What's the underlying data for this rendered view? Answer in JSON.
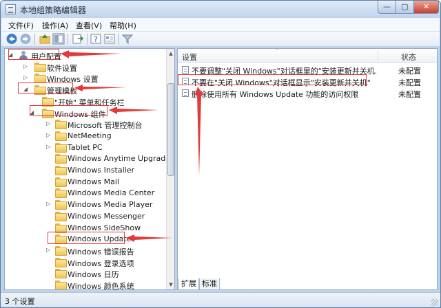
{
  "window": {
    "title": "本地组策略编辑器",
    "controls": {
      "minimize": "—",
      "maximize": "▢",
      "close": "✕"
    }
  },
  "menu": [
    "文件(F)",
    "操作(A)",
    "查看(V)",
    "帮助(H)"
  ],
  "toolbar": {
    "buttons": [
      "back-arrow-icon",
      "forward-arrow-icon",
      "up-folder-icon",
      "show-tree-icon",
      "export-icon",
      "help-icon",
      "properties-icon",
      "filter-icon"
    ]
  },
  "tree": [
    {
      "label": "用户配置",
      "level": 0,
      "expanded": true,
      "icon": "user-icon"
    },
    {
      "label": "软件设置",
      "level": 1,
      "expanded": false,
      "icon": "folder-icon"
    },
    {
      "label": "Windows 设置",
      "level": 1,
      "expanded": false,
      "icon": "folder-icon"
    },
    {
      "label": "管理模板",
      "level": 1,
      "expanded": true,
      "icon": "folder-icon"
    },
    {
      "label": "\"开始\" 菜单和任务栏",
      "level": 2,
      "expanded": null,
      "icon": "folder-icon"
    },
    {
      "label": "Windows 组件",
      "level": 2,
      "expanded": true,
      "icon": "folder-icon"
    },
    {
      "label": "Microsoft 管理控制台",
      "level": 3,
      "expanded": false,
      "icon": "folder-icon"
    },
    {
      "label": "NetMeeting",
      "level": 3,
      "expanded": false,
      "icon": "folder-icon"
    },
    {
      "label": "Tablet PC",
      "level": 3,
      "expanded": false,
      "icon": "folder-icon"
    },
    {
      "label": "Windows Anytime Upgrade",
      "level": 3,
      "expanded": null,
      "icon": "folder-icon"
    },
    {
      "label": "Windows Installer",
      "level": 3,
      "expanded": null,
      "icon": "folder-icon"
    },
    {
      "label": "Windows Mail",
      "level": 3,
      "expanded": null,
      "icon": "folder-icon"
    },
    {
      "label": "Windows Media Center",
      "level": 3,
      "expanded": null,
      "icon": "folder-icon"
    },
    {
      "label": "Windows Media Player",
      "level": 3,
      "expanded": false,
      "icon": "folder-icon"
    },
    {
      "label": "Windows Messenger",
      "level": 3,
      "expanded": null,
      "icon": "folder-icon"
    },
    {
      "label": "Windows SideShow",
      "level": 3,
      "expanded": null,
      "icon": "folder-icon"
    },
    {
      "label": "Windows Update",
      "level": 3,
      "expanded": null,
      "icon": "folder-icon"
    },
    {
      "label": "Windows 错误报告",
      "level": 3,
      "expanded": false,
      "icon": "folder-icon"
    },
    {
      "label": "Windows 登录选项",
      "level": 3,
      "expanded": null,
      "icon": "folder-icon"
    },
    {
      "label": "Windows 日历",
      "level": 3,
      "expanded": null,
      "icon": "folder-icon"
    },
    {
      "label": "Windows 颜色系统",
      "level": 3,
      "expanded": null,
      "icon": "folder-icon"
    }
  ],
  "details": {
    "columns": {
      "setting": "设置",
      "state": "状态"
    },
    "rows": [
      {
        "text": "不要调整\"关闭 Windows\"对话框里的\"安装更新并关机...",
        "state": "未配置"
      },
      {
        "text": "不要在\"关闭 Windows\"对话框显示\"安装更新并关机\"",
        "state": "未配置"
      },
      {
        "text": "删除使用所有 Windows Update 功能的访问权限",
        "state": "未配置"
      }
    ]
  },
  "tabs": [
    "扩展",
    "标准"
  ],
  "status": {
    "text": "3 个设置"
  },
  "colors": {
    "annotation": "#e23a3a",
    "folder": "#efc456",
    "titlebar": "#bfd4ec"
  }
}
